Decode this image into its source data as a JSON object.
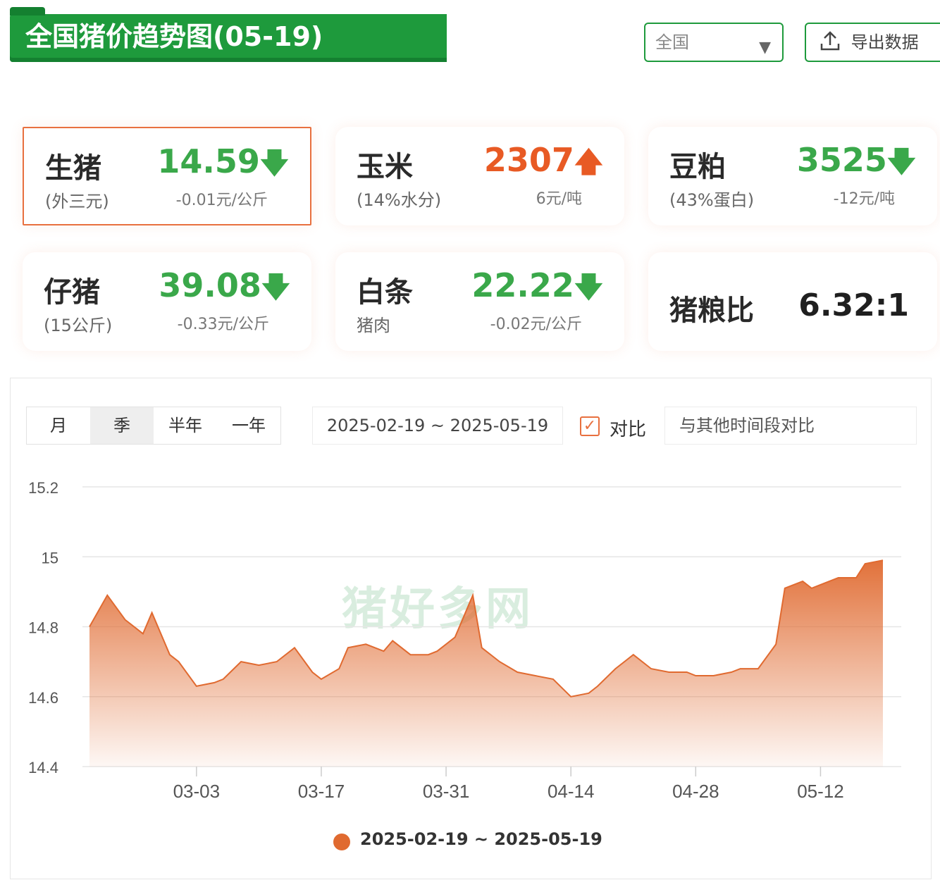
{
  "header": {
    "title": "全国猪价趋势图(05-19)",
    "region": "全国",
    "export_label": "导出数据"
  },
  "cards": [
    {
      "name": "生猪",
      "sub": "(外三元)",
      "value": "14.59",
      "trend": "down",
      "change": "-0.01元/公斤"
    },
    {
      "name": "玉米",
      "sub": "(14%水分)",
      "value": "2307",
      "trend": "up",
      "change": "6元/吨"
    },
    {
      "name": "豆粕",
      "sub": "(43%蛋白)",
      "value": "3525",
      "trend": "down",
      "change": "-12元/吨"
    },
    {
      "name": "仔猪",
      "sub": "(15公斤)",
      "value": "39.08",
      "trend": "down",
      "change": "-0.33元/公斤"
    },
    {
      "name": "白条",
      "sub": "猪肉",
      "value": "22.22",
      "trend": "down",
      "change": "-0.02元/公斤"
    },
    {
      "name": "猪粮比",
      "value": "6.32:1"
    }
  ],
  "controls": {
    "periods": [
      "月",
      "季",
      "半年",
      "一年"
    ],
    "selected_period": "季",
    "date_range": "2025-02-19 ~ 2025-05-19",
    "compare_label": "对比",
    "compare_checked": true,
    "compare_placeholder": "与其他时间段对比"
  },
  "watermark": "猪好多网",
  "colors": {
    "brand": "#1e9a3c",
    "up": "#e85a24",
    "down": "#3aa84a",
    "series": "#e06a30"
  },
  "chart_data": {
    "type": "area",
    "x_ticks": [
      "03-03",
      "03-17",
      "03-31",
      "04-14",
      "04-28",
      "05-12"
    ],
    "y_ticks": [
      "15.2",
      "15",
      "14.8",
      "14.6",
      "14.4"
    ],
    "ylim": [
      14.4,
      15.2
    ],
    "xlim": [
      "2025-02-19",
      "2025-05-19"
    ],
    "grid": true,
    "legend_position": "bottom",
    "series": [
      {
        "name": "2025-02-19 ~ 2025-05-19",
        "points": [
          [
            "2025-02-19",
            14.8
          ],
          [
            "2025-02-21",
            14.89
          ],
          [
            "2025-02-23",
            14.82
          ],
          [
            "2025-02-25",
            14.78
          ],
          [
            "2025-02-26",
            14.84
          ],
          [
            "2025-02-28",
            14.72
          ],
          [
            "2025-03-01",
            14.7
          ],
          [
            "2025-03-03",
            14.63
          ],
          [
            "2025-03-05",
            14.64
          ],
          [
            "2025-03-06",
            14.65
          ],
          [
            "2025-03-08",
            14.7
          ],
          [
            "2025-03-10",
            14.69
          ],
          [
            "2025-03-12",
            14.7
          ],
          [
            "2025-03-14",
            14.74
          ],
          [
            "2025-03-16",
            14.67
          ],
          [
            "2025-03-17",
            14.65
          ],
          [
            "2025-03-19",
            14.68
          ],
          [
            "2025-03-20",
            14.74
          ],
          [
            "2025-03-22",
            14.75
          ],
          [
            "2025-03-24",
            14.73
          ],
          [
            "2025-03-25",
            14.76
          ],
          [
            "2025-03-27",
            14.72
          ],
          [
            "2025-03-29",
            14.72
          ],
          [
            "2025-03-30",
            14.73
          ],
          [
            "2025-04-01",
            14.77
          ],
          [
            "2025-04-03",
            14.89
          ],
          [
            "2025-04-04",
            14.74
          ],
          [
            "2025-04-06",
            14.7
          ],
          [
            "2025-04-08",
            14.67
          ],
          [
            "2025-04-10",
            14.66
          ],
          [
            "2025-04-12",
            14.65
          ],
          [
            "2025-04-14",
            14.6
          ],
          [
            "2025-04-16",
            14.61
          ],
          [
            "2025-04-17",
            14.63
          ],
          [
            "2025-04-19",
            14.68
          ],
          [
            "2025-04-21",
            14.72
          ],
          [
            "2025-04-23",
            14.68
          ],
          [
            "2025-04-25",
            14.67
          ],
          [
            "2025-04-27",
            14.67
          ],
          [
            "2025-04-28",
            14.66
          ],
          [
            "2025-04-30",
            14.66
          ],
          [
            "2025-05-02",
            14.67
          ],
          [
            "2025-05-03",
            14.68
          ],
          [
            "2025-05-05",
            14.68
          ],
          [
            "2025-05-07",
            14.75
          ],
          [
            "2025-05-08",
            14.91
          ],
          [
            "2025-05-10",
            14.93
          ],
          [
            "2025-05-11",
            14.91
          ],
          [
            "2025-05-12",
            14.92
          ],
          [
            "2025-05-14",
            14.94
          ],
          [
            "2025-05-16",
            14.94
          ],
          [
            "2025-05-17",
            14.98
          ],
          [
            "2025-05-19",
            14.99
          ]
        ]
      }
    ]
  }
}
